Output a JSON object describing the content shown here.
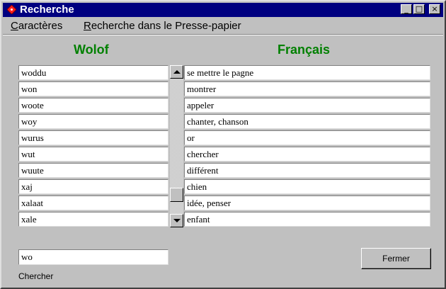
{
  "window": {
    "title": "Recherche",
    "minimize_glyph": "_",
    "maximize_glyph": "□",
    "close_glyph": "×"
  },
  "menu": [
    {
      "label_accel": "C",
      "label_rest": "aractères"
    },
    {
      "label_accel": "R",
      "label_rest": "echerche dans le Presse-papier"
    }
  ],
  "columns": {
    "left_header": "Wolof",
    "right_header": "Français",
    "header_color": "#008000"
  },
  "rows": [
    {
      "wolof": "woddu",
      "francais": "se mettre le pagne"
    },
    {
      "wolof": "won",
      "francais": "montrer"
    },
    {
      "wolof": "woote",
      "francais": "appeler"
    },
    {
      "wolof": "woy",
      "francais": "chanter, chanson"
    },
    {
      "wolof": "wurus",
      "francais": "or"
    },
    {
      "wolof": "wut",
      "francais": "chercher"
    },
    {
      "wolof": "wuute",
      "francais": "différent"
    },
    {
      "wolof": "xaj",
      "francais": "chien"
    },
    {
      "wolof": "xalaat",
      "francais": "idée, penser"
    },
    {
      "wolof": "xale",
      "francais": "enfant"
    }
  ],
  "scrollbar": {
    "position_fraction": 0.9
  },
  "search": {
    "value": "wo",
    "label": "Chercher"
  },
  "buttons": {
    "close_label": "Fermer"
  },
  "icons": {
    "app": "red-diamond-icon",
    "scroll_up": "arrow-up-icon",
    "scroll_down": "arrow-down-icon"
  }
}
